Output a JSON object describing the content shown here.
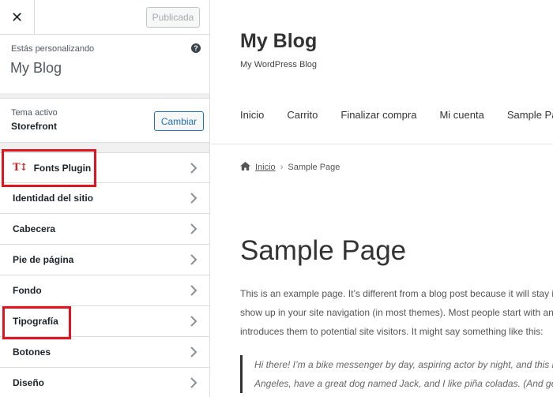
{
  "header": {
    "close_label": "✕",
    "publish_label": "Publicada"
  },
  "customizing": {
    "label": "Estás personalizando",
    "site_name": "My Blog",
    "help_glyph": "?"
  },
  "theme": {
    "label": "Tema activo",
    "name": "Storefront",
    "change_label": "Cambiar"
  },
  "panels": [
    {
      "label": "Fonts Plugin",
      "icon": "tt-fonts-icon",
      "icon_glyph": "T↕",
      "highlighted": true
    },
    {
      "label": "Identidad del sitio"
    },
    {
      "label": "Cabecera"
    },
    {
      "label": "Pie de página"
    },
    {
      "label": "Fondo"
    },
    {
      "label": "Tipografía",
      "highlighted": true
    },
    {
      "label": "Botones"
    },
    {
      "label": "Diseño"
    }
  ],
  "colors": {
    "highlight": "#e0141e",
    "accent": "#2271b1",
    "fonts_icon": "#c62828"
  },
  "preview": {
    "blog_title": "My Blog",
    "tagline": "My WordPress Blog",
    "nav": [
      "Inicio",
      "Carrito",
      "Finalizar compra",
      "Mi cuenta",
      "Sample Page"
    ],
    "breadcrumb": {
      "home": "Inicio",
      "separator": "›",
      "current": "Sample Page"
    },
    "page_title": "Sample Page",
    "paragraph_lines": [
      "This is an example page. It’s different from a blog post because it will stay in one place and will",
      "show up in your site navigation (in most themes). Most people start with an About page that",
      "introduces them to potential site visitors. It might say something like this:"
    ],
    "quote_lines": [
      "Hi there! I’m a bike messenger by day, aspiring actor by night, and this is my website. I live in Los",
      "Angeles, have a great dog named Jack, and I like piña coladas. (And gettin’ caught in the rain.)"
    ]
  }
}
